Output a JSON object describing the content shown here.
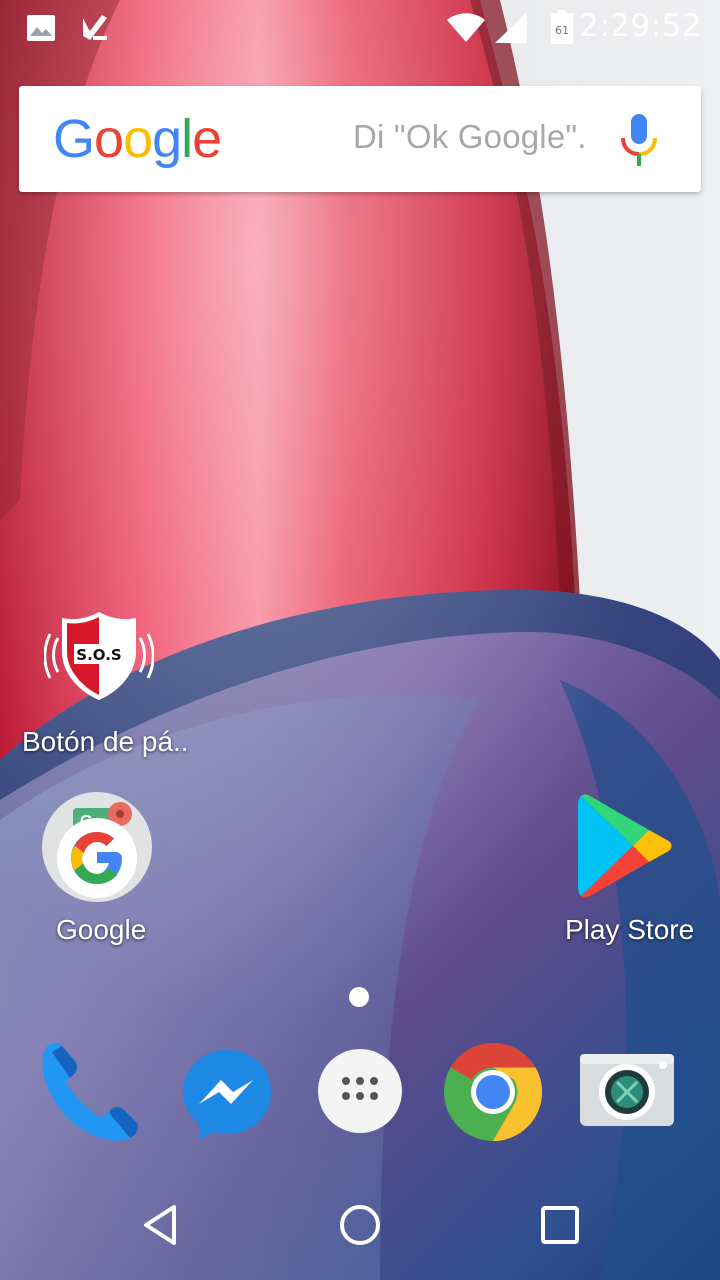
{
  "status_bar": {
    "time": "2:29:52",
    "icons": [
      "image-notification-icon",
      "task-check-icon",
      "wifi-icon",
      "signal-icon",
      "battery-icon"
    ],
    "battery_level": "61"
  },
  "search": {
    "logo_text": "Google",
    "hint": "Di \"Ok Google\".",
    "colors": {
      "blue": "#4285F4",
      "red": "#EA4335",
      "yellow": "#FBBC05",
      "green": "#34A853"
    }
  },
  "desktop_apps": [
    {
      "label": "Botón de pá..",
      "icon": "sos-shield-icon",
      "badge": "S.O.S"
    },
    {
      "label": "Google",
      "icon": "google-app-icon"
    },
    {
      "label": "Play Store",
      "icon": "play-store-icon"
    }
  ],
  "dock": [
    {
      "name": "phone",
      "icon": "phone-icon"
    },
    {
      "name": "messenger",
      "icon": "messenger-icon"
    },
    {
      "name": "app-drawer",
      "icon": "app-drawer-icon"
    },
    {
      "name": "chrome",
      "icon": "chrome-icon"
    },
    {
      "name": "camera",
      "icon": "camera-icon"
    }
  ],
  "nav_bar": [
    "back-icon",
    "home-icon",
    "recents-icon"
  ]
}
